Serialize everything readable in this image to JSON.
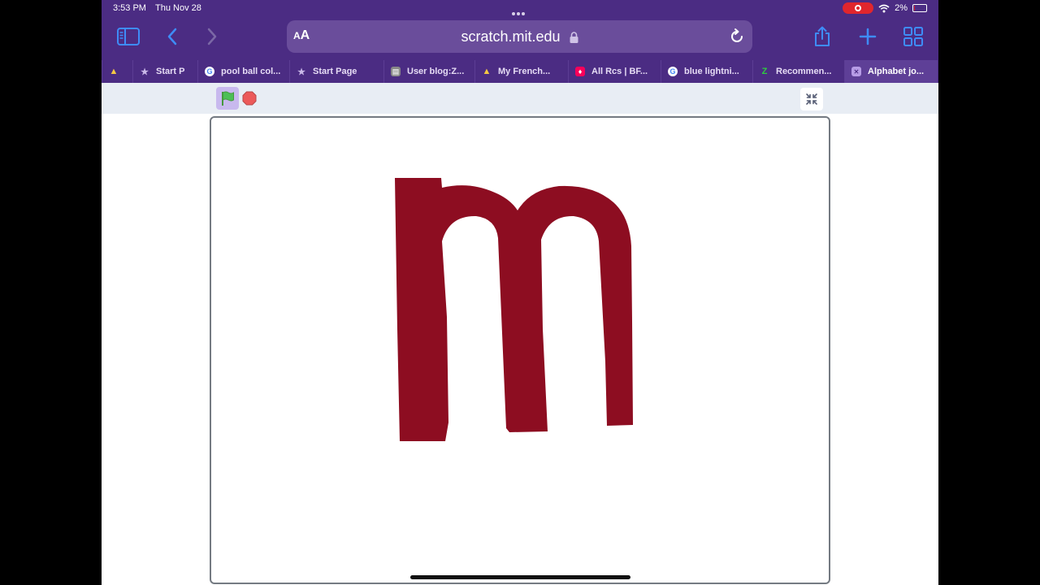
{
  "status_bar": {
    "time": "3:53 PM",
    "date": "Thu Nov 28",
    "battery_percent": "2%",
    "screen_recording": true
  },
  "browser": {
    "address_bar": {
      "text_size_label": "AA",
      "url": "scratch.mit.edu",
      "secure": true
    },
    "tabs": [
      {
        "title": "",
        "favicon": "scratch-cat-icon",
        "favicon_color": "#f7c843",
        "active": false
      },
      {
        "title": "Start P",
        "favicon": "star-icon",
        "favicon_color": "#c9b8e8",
        "active": false
      },
      {
        "title": "pool ball col...",
        "favicon": "google-icon",
        "favicon_color": "#ffffff",
        "active": false
      },
      {
        "title": "Start Page",
        "favicon": "star-icon",
        "favicon_color": "#c9b8e8",
        "active": false
      },
      {
        "title": "User blog:Z...",
        "favicon": "fandom-page-icon",
        "favicon_color": "#aaaaaa",
        "active": false
      },
      {
        "title": "My French...",
        "favicon": "scratch-cat-icon",
        "favicon_color": "#f7c843",
        "active": false
      },
      {
        "title": "All Rcs | BF...",
        "favicon": "fandom-fire-icon",
        "favicon_color": "#fa005a",
        "active": false
      },
      {
        "title": "blue lightni...",
        "favicon": "google-icon",
        "favicon_color": "#ffffff",
        "active": false
      },
      {
        "title": "Recommen...",
        "favicon": "z-logo-icon",
        "favicon_color": "#2ecc40",
        "active": false
      },
      {
        "title": "Alphabet jo...",
        "favicon": "close-tab-icon",
        "favicon_color": "#b79ce6",
        "active": true
      }
    ]
  },
  "scratch": {
    "letter_color": "#8d0d21",
    "flag_color": "#4cbf56",
    "stop_color": "#ec5959"
  }
}
